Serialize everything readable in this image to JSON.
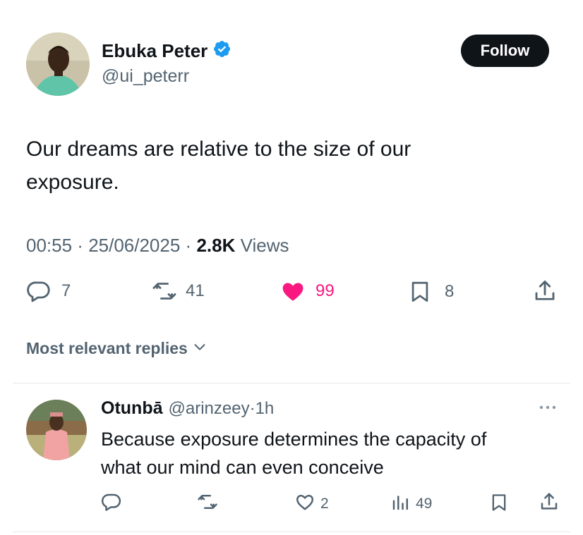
{
  "tweet": {
    "author": {
      "name": "Ebuka Peter",
      "handle": "@ui_peterr",
      "verified": true,
      "verified_color": "#1d9bf0"
    },
    "follow_label": "Follow",
    "text_line1": "Our dreams are relative to the size of our",
    "text_line2": "exposure.",
    "time": "00:55",
    "date": "25/06/2025",
    "views_count": "2.8K",
    "views_label": "Views",
    "stats": {
      "replies": "7",
      "reposts": "41",
      "likes": "99",
      "bookmarks": "8"
    },
    "like_color": "#f91880"
  },
  "replies_filter": {
    "label": "Most relevant replies"
  },
  "reply": {
    "name": "Otunbā",
    "handle": "@arinzeey",
    "time": "1h",
    "text_line1": "Because exposure determines the capacity of",
    "text_line2": "what our mind can even conceive",
    "stats": {
      "likes": "2",
      "views": "49"
    }
  }
}
